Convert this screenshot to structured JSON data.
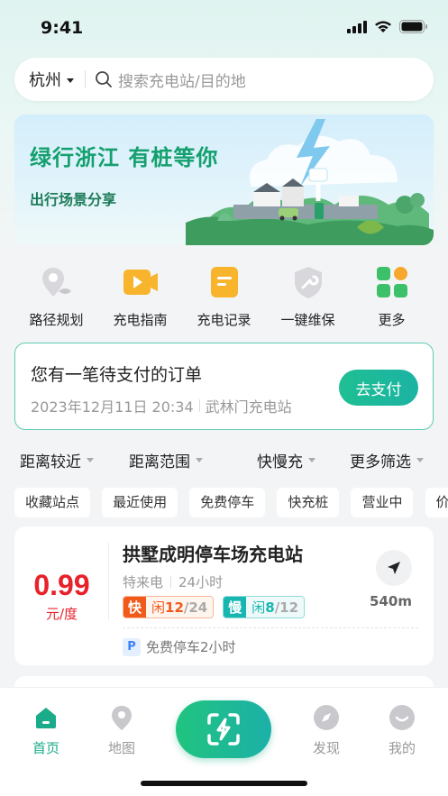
{
  "status_bar": {
    "time": "9:41"
  },
  "search": {
    "city": "杭州",
    "placeholder": "搜索充电站/目的地"
  },
  "banner": {
    "title": "绿行浙江 有桩等你",
    "subtitle": "出行场景分享"
  },
  "quick_actions": [
    {
      "label": "路径规划",
      "icon": "route-pin-icon"
    },
    {
      "label": "充电指南",
      "icon": "video-guide-icon"
    },
    {
      "label": "充电记录",
      "icon": "record-icon"
    },
    {
      "label": "一键维保",
      "icon": "wrench-shield-icon"
    },
    {
      "label": "更多",
      "icon": "grid-more-icon"
    }
  ],
  "order": {
    "title": "您有一笔待支付的订单",
    "datetime": "2023年12月11日 20:34",
    "station": "武林门充电站",
    "pay_label": "去支付"
  },
  "filters": [
    {
      "label": "距离较近"
    },
    {
      "label": "距离范围"
    },
    {
      "label": "快慢充"
    },
    {
      "label": "更多筛选"
    }
  ],
  "chips": [
    "收藏站点",
    "最近使用",
    "免费停车",
    "快充桩",
    "营业中",
    "价"
  ],
  "station": {
    "price": "0.99",
    "price_unit": "元/度",
    "name": "拱墅成明停车场充电站",
    "type": "特来电",
    "hours": "24小时",
    "fast": {
      "tag": "快",
      "prefix": "闲",
      "free": "12",
      "total": "/24"
    },
    "slow": {
      "tag": "慢",
      "prefix": "闲",
      "free": "8",
      "total": "/12"
    },
    "distance": "540m",
    "parking_badge": "P",
    "parking_text": "免费停车2小时"
  },
  "tabbar": [
    {
      "label": "首页",
      "active": true
    },
    {
      "label": "地图",
      "active": false
    },
    {
      "label": "发现",
      "active": false
    },
    {
      "label": "我的",
      "active": false
    }
  ],
  "colors": {
    "accent": "#1aab8a",
    "price": "#e8222a",
    "fast": "#f05a1a",
    "slow": "#18b6b0"
  }
}
